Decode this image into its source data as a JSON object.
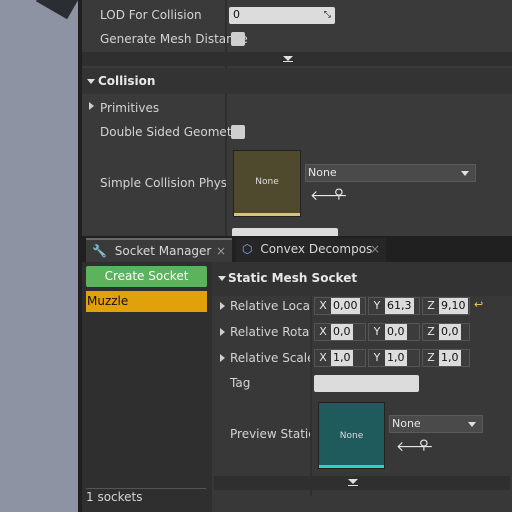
{
  "details": {
    "lod_for_collision": {
      "label": "LOD For Collision",
      "value": "0"
    },
    "generate_mesh_distance": {
      "label": "Generate Mesh Distance"
    },
    "collision_section": {
      "title": "Collision"
    },
    "primitives": {
      "label": "Primitives"
    },
    "double_sided_geometry": {
      "label": "Double Sided Geometry"
    },
    "simple_collision": {
      "label": "Simple Collision Physical",
      "thumb_text": "None",
      "combo_value": "None"
    }
  },
  "tabs": [
    {
      "label": "Socket Manager"
    },
    {
      "label": "Convex Decompos"
    }
  ],
  "socket_manager": {
    "create_button": "Create Socket",
    "sockets": [
      "Muzzle"
    ],
    "count_text": "1 sockets"
  },
  "static_mesh_socket": {
    "title": "Static Mesh Socket",
    "relative_location": {
      "label": "Relative Locatio",
      "x": "0,00",
      "y": "61,3",
      "z": "9,10"
    },
    "relative_rotation": {
      "label": "Relative Rotatio",
      "x": "0,0",
      "y": "0,0",
      "z": "0,0"
    },
    "relative_scale": {
      "label": "Relative Scale",
      "x": "1,0",
      "y": "1,0",
      "z": "1,0"
    },
    "tag": {
      "label": "Tag",
      "value": ""
    },
    "preview_static_mesh": {
      "label": "Preview Static M",
      "thumb_text": "None",
      "combo_value": "None"
    }
  },
  "axis_letters": {
    "x": "X",
    "y": "Y",
    "z": "Z"
  },
  "colors": {
    "socket_selected": "#e0a10a",
    "create_button": "#5cb35e",
    "mesh_thumb": "#1f5a5c",
    "mesh_thumb_underline": "#2fd0d0",
    "collision_thumb": "#4f4a2e",
    "collision_thumb_underline": "#d9c27a"
  }
}
